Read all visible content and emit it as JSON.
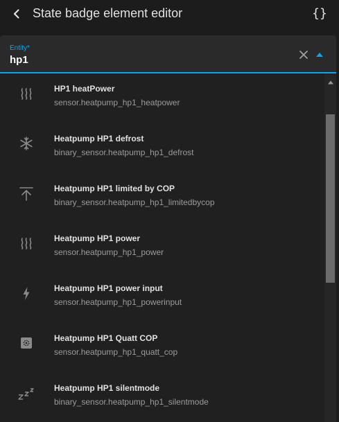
{
  "header": {
    "title": "State badge element editor",
    "code_icon": "{}"
  },
  "entity_field": {
    "label": "Entity*",
    "value": "hp1",
    "accent_color": "#03a9f4"
  },
  "icons": {
    "back": "back-arrow-icon",
    "clear": "close-icon",
    "toggle": "triangle-up-icon",
    "scroll_up": "scroll-up-arrow-icon"
  },
  "items": [
    {
      "name": "HP1 heatPower",
      "entity_id": "sensor.heatpump_hp1_heatpower",
      "icon": "heat-wave-icon"
    },
    {
      "name": "Heatpump HP1 defrost",
      "entity_id": "binary_sensor.heatpump_hp1_defrost",
      "icon": "snowflake-icon"
    },
    {
      "name": "Heatpump HP1 limited by COP",
      "entity_id": "binary_sensor.heatpump_hp1_limitedbycop",
      "icon": "arrow-collapse-up-icon"
    },
    {
      "name": "Heatpump HP1 power",
      "entity_id": "sensor.heatpump_hp1_power",
      "icon": "heat-wave-icon"
    },
    {
      "name": "Heatpump HP1 power input",
      "entity_id": "sensor.heatpump_hp1_powerinput",
      "icon": "lightning-bolt-icon"
    },
    {
      "name": "Heatpump HP1 Quatt COP",
      "entity_id": "sensor.heatpump_hp1_quatt_cop",
      "icon": "eye-box-icon"
    },
    {
      "name": "Heatpump HP1 silentmode",
      "entity_id": "binary_sensor.heatpump_hp1_silentmode",
      "icon": "sleep-icon"
    }
  ]
}
